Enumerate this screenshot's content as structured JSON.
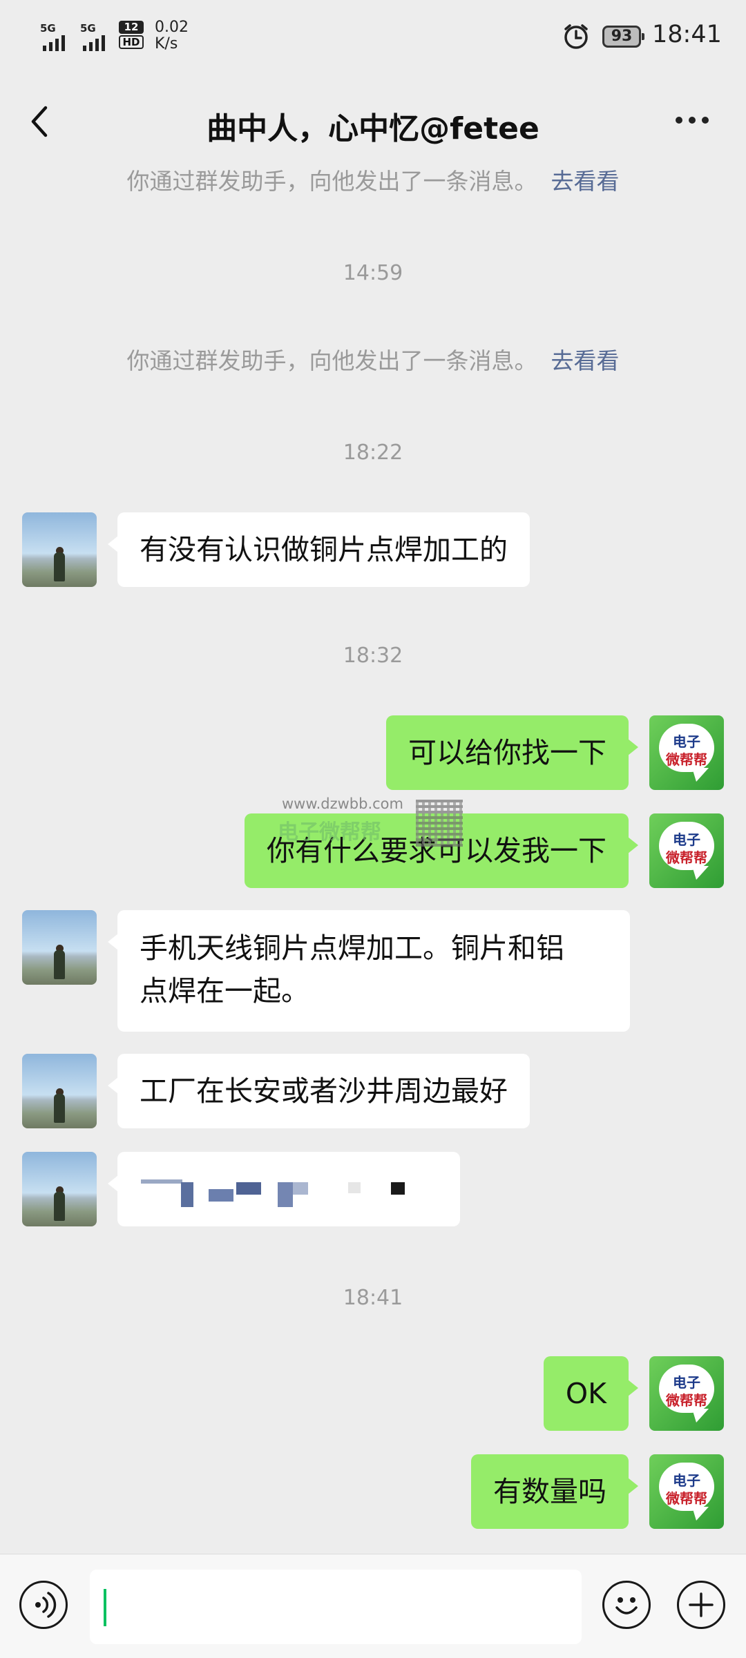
{
  "status_bar": {
    "sim1": "5G",
    "sim2": "5G",
    "hd_top": "12",
    "hd_bottom": "HD",
    "speed_value": "0.02",
    "speed_unit": "K/s",
    "alarm_icon": "alarm-clock-icon",
    "battery": "93",
    "time": "18:41"
  },
  "header": {
    "title": "曲中人，心中忆@fetee",
    "back_icon": "chevron-left-icon",
    "more_icon": "more-dots-icon"
  },
  "messages": {
    "sys1_text": "你通过群发助手，向他发出了一条消息。",
    "sys1_link": "去看看",
    "time1": "14:59",
    "sys2_text": "你通过群发助手，向他发出了一条消息。",
    "sys2_link": "去看看",
    "time2": "18:22",
    "m1": "有没有认识做铜片点焊加工的",
    "time3": "18:32",
    "m2": "可以给你找一下",
    "m3": "你有什么要求可以发我一下",
    "m4_line1": "手机天线铜片点焊加工。铜片和铝",
    "m4_line2": "点焊在一起。",
    "m5": "工厂在长安或者沙井周边最好",
    "time4": "18:41",
    "m7": "OK",
    "m8": "有数量吗"
  },
  "my_avatar": {
    "line1": "电子",
    "line2": "微帮帮"
  },
  "watermark": {
    "url": "www.dzwbb.com",
    "brand": "电子微帮帮"
  },
  "input_bar": {
    "voice_icon": "voice-icon",
    "emoji_icon": "emoji-icon",
    "plus_icon": "plus-icon"
  },
  "colors": {
    "background": "#ededed",
    "outgoing_bubble": "#95ec69",
    "incoming_bubble": "#ffffff",
    "link": "#576b95",
    "caret": "#07c160"
  }
}
